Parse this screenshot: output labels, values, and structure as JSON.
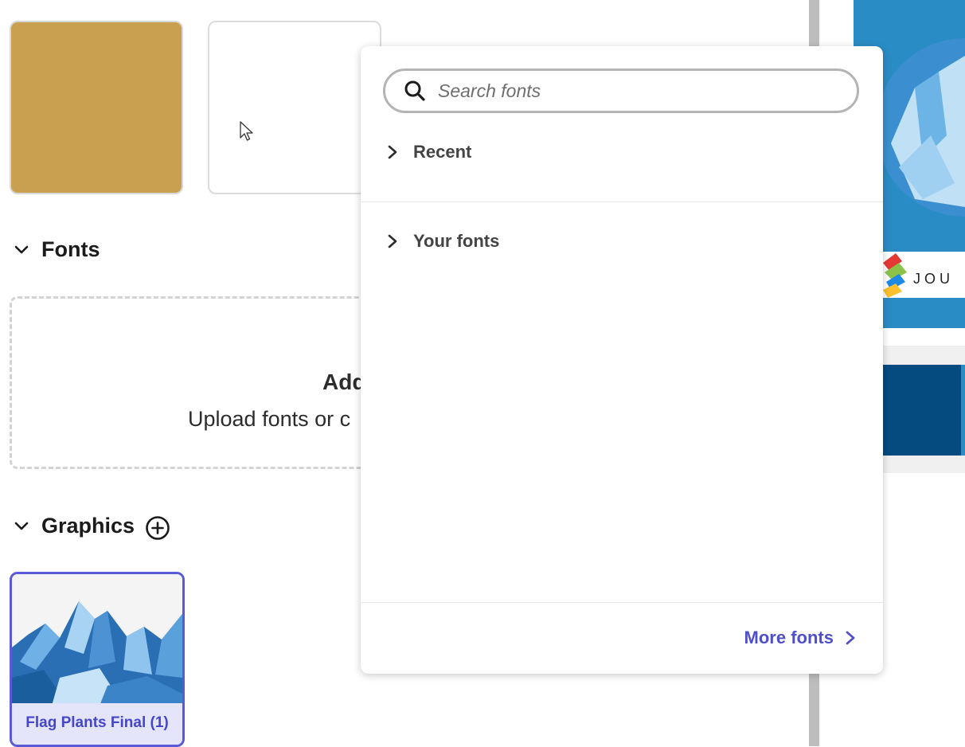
{
  "colors": {
    "swatch_gold": "#c9a050",
    "accent": "#5a5ad6",
    "link": "#4f4fcc"
  },
  "fonts_section": {
    "title": "Fonts",
    "dropzone_title": "Add",
    "dropzone_subtitle": "Upload fonts or c"
  },
  "graphics_section": {
    "title": "Graphics",
    "items": [
      {
        "caption": "Flag Plants Final (1)"
      }
    ]
  },
  "font_picker": {
    "search_placeholder": "Search fonts",
    "groups": [
      {
        "label": "Recent"
      },
      {
        "label": "Your fonts"
      }
    ],
    "more_link": "More fonts"
  },
  "side_preview": {
    "brand_text": "JOU"
  }
}
